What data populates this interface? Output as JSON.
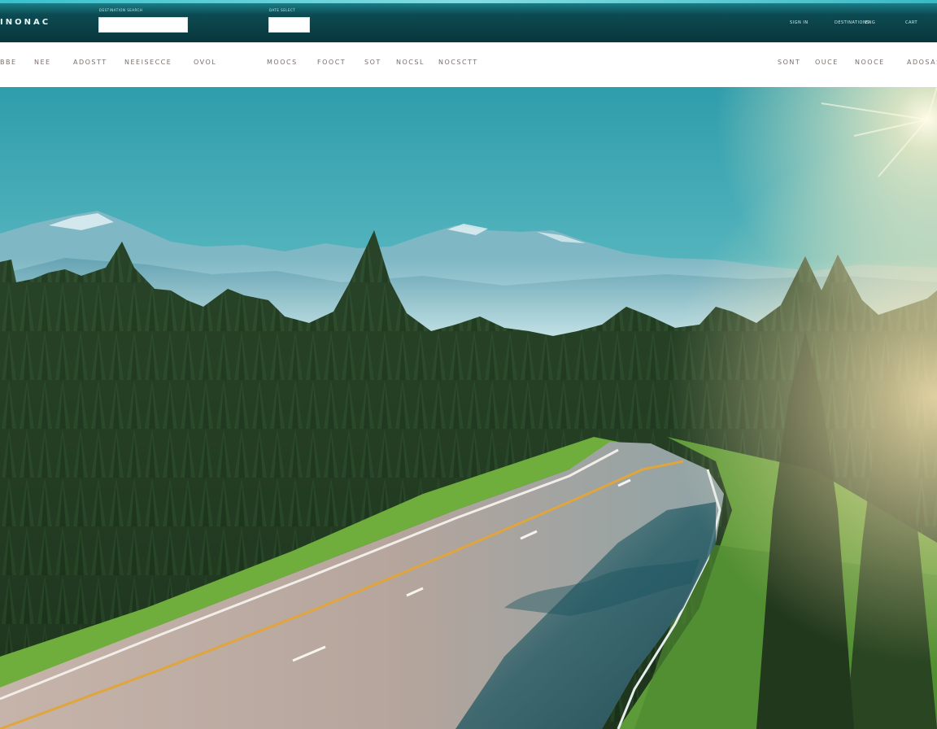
{
  "header": {
    "logo": "INONAC",
    "search_field_1": {
      "label": "DESTINATION SEARCH",
      "value": ""
    },
    "search_field_2": {
      "label": "DATE SELECT",
      "value": ""
    },
    "utility_links": [
      "SIGN IN",
      "DESTINATIONS",
      "ENG",
      "CART"
    ]
  },
  "nav": {
    "left_items": [
      "BBE",
      "NEE",
      "ADOSTT",
      "NEEISECCE",
      "OVOL"
    ],
    "center_items": [
      "MOOCS",
      "FOOCT",
      "SOT",
      "NOCSL",
      "NOCSCTT"
    ],
    "right_items": [
      "SONT",
      "OUCE",
      "NOOCE",
      "ADOSAS"
    ]
  },
  "hero": {
    "image": "mountain-forest-road-photo",
    "colors": {
      "sky_top": "#2f9dab",
      "sky_low": "#a9e3e6",
      "forest": "#1e3a1f",
      "road": "#b7a8a0",
      "grass": "#7ec04a"
    }
  }
}
